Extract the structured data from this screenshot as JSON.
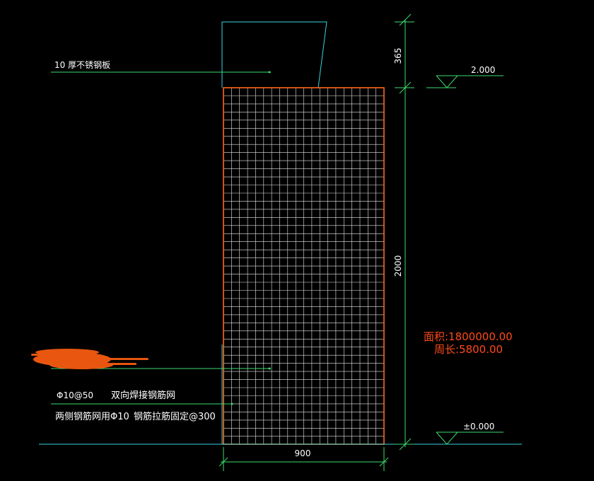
{
  "drawing": {
    "annotations": {
      "plate_label": "10  厚不锈钢板",
      "mesh_label_a": "Φ10@50",
      "mesh_label_b": "双向焊接钢筋网",
      "tie_label_a": "两侧钢筋网用Φ10",
      "tie_label_b": "钢筋拉筋固定@300"
    },
    "dimensions": {
      "top_height": "365",
      "wall_height": "2000",
      "width": "900"
    },
    "elevations": {
      "top": "2.000",
      "ground": "±0.000"
    },
    "properties": {
      "area": "面积:1800000.00",
      "perimeter": "周长:5800.00"
    },
    "colors": {
      "background": "#000000",
      "wall_outline": "#ff6a1a",
      "grid": "#e6e6e6",
      "cyan": "#39d3e0",
      "green": "#3ddc6e",
      "white_text": "#ffffff",
      "orange_text": "#ff4a1a",
      "redaction": "#e8560f"
    }
  }
}
